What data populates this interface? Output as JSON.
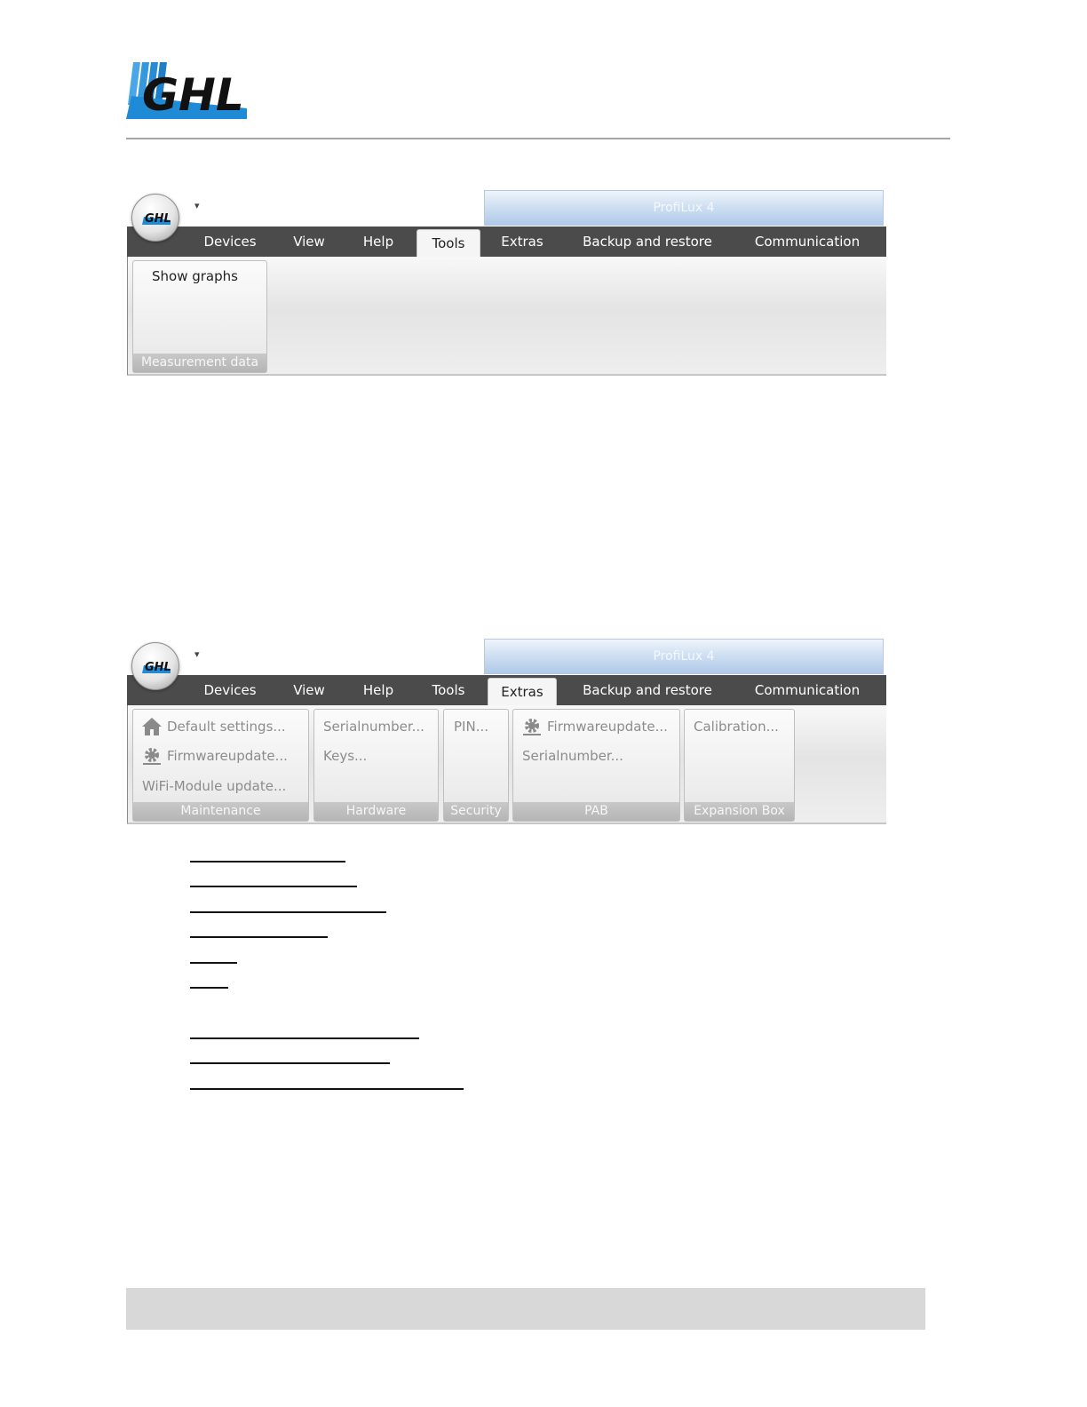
{
  "brand": {
    "logo_text": "GHL"
  },
  "ribbon_tools": {
    "app_title": "ProfiLux 4",
    "orb_text": "GHL",
    "qat_glyph": "▾",
    "tabs": [
      "Devices",
      "View",
      "Help",
      "Tools",
      "Extras",
      "Backup and restore",
      "Communication"
    ],
    "active_tab": "Tools",
    "groups": [
      {
        "label": "Measurement data",
        "items": [
          {
            "label": "Show graphs",
            "enabled": true
          }
        ]
      }
    ]
  },
  "ribbon_extras": {
    "app_title": "ProfiLux 4",
    "orb_text": "GHL",
    "qat_glyph": "▾",
    "tabs": [
      "Devices",
      "View",
      "Help",
      "Tools",
      "Extras",
      "Backup and restore",
      "Communication"
    ],
    "active_tab": "Extras",
    "groups": [
      {
        "label": "Maintenance",
        "items": [
          {
            "label": "Default settings...",
            "icon": "home-icon",
            "enabled": false
          },
          {
            "label": "Firmwareupdate...",
            "icon": "gear-icon",
            "enabled": false
          },
          {
            "label": "WiFi-Module update...",
            "enabled": false
          }
        ]
      },
      {
        "label": "Hardware",
        "items": [
          {
            "label": "Serialnumber...",
            "enabled": false
          },
          {
            "label": "Keys...",
            "enabled": false
          }
        ]
      },
      {
        "label": "Security",
        "items": [
          {
            "label": "PIN...",
            "enabled": false
          }
        ]
      },
      {
        "label": "PAB",
        "items": [
          {
            "label": "Firmwareupdate...",
            "icon": "gear-icon",
            "enabled": false
          },
          {
            "label": "Serialnumber...",
            "enabled": false
          }
        ]
      },
      {
        "label": "Expansion Box",
        "items": [
          {
            "label": "Calibration...",
            "enabled": false
          }
        ]
      }
    ]
  },
  "colors": {
    "tab_bar": "#4b4b4b",
    "logo_blue": "#1f8ad6",
    "title_bar": "#c9dbf0"
  }
}
